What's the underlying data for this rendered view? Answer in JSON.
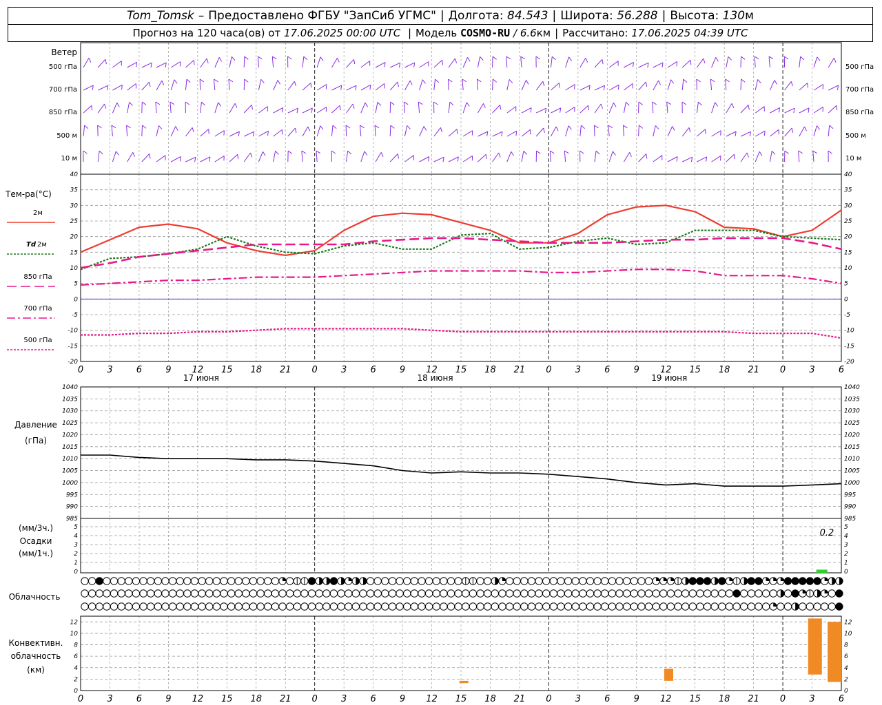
{
  "header": {
    "station": "Tom_Tomsk",
    "dash": "–",
    "provider": "Предоставлено ФГБУ \"ЗапСиб УГМС\"",
    "lon_label": "Долгота:",
    "lon_value": "84.543",
    "lat_label": "Широта:",
    "lat_value": "56.288",
    "alt_label": "Высота:",
    "alt_value": "130",
    "alt_unit": "м"
  },
  "subheader": {
    "forecast_label": "Прогноз на 120 часа(ов) от",
    "forecast_time": "17.06.2025 00:00 UTC",
    "model_label": "Модель",
    "model_name": "COSMO-RU",
    "model_res": "/ 6.6",
    "model_res_unit": "км",
    "computed_label": "Рассчитано:",
    "computed_time": "17.06.2025 04:39 UTC"
  },
  "colors": {
    "wind": "#8a2be2",
    "t2m": "#ee3b30",
    "td2m": "#1a7a1a",
    "t850": "#e8178a",
    "t700": "#e8178a",
    "t500": "#e8178a",
    "zero": "#3030dd",
    "pressure": "#000000",
    "precip": "#33cc33",
    "conv": "#f08a24",
    "grid": "#9a9a9a"
  },
  "chart_data": {
    "type": "meteogram",
    "time_hours": [
      0,
      3,
      6,
      9,
      12,
      15,
      18,
      21,
      24,
      27,
      30,
      33,
      36,
      39,
      42,
      45,
      48,
      51,
      54,
      57,
      60,
      63,
      66,
      69,
      72,
      75,
      78
    ],
    "hour_tick_labels": [
      "0",
      "3",
      "6",
      "9",
      "12",
      "15",
      "18",
      "21",
      "0",
      "3",
      "6",
      "9",
      "12",
      "15",
      "18",
      "21",
      "0",
      "3",
      "6",
      "9",
      "12",
      "15",
      "18",
      "21",
      "0",
      "3",
      "6"
    ],
    "day_labels": [
      "17 июня",
      "18 июня",
      "19 июня"
    ],
    "wind": {
      "title": "Ветер",
      "levels": [
        "500 гПа",
        "700 гПа",
        "850 гПа",
        "500 м",
        "10 м"
      ]
    },
    "temperature": {
      "title": "Тем-ра(°C)",
      "ylim": [
        -20,
        40
      ],
      "ticks": [
        40,
        35,
        30,
        25,
        20,
        15,
        10,
        5,
        0,
        -5,
        -10,
        -15,
        -20
      ],
      "series": [
        {
          "name": "2м",
          "style": "solid",
          "x": [
            0,
            3,
            6,
            9,
            12,
            15,
            18,
            21,
            24,
            27,
            30,
            33,
            36,
            39,
            42,
            45,
            48,
            51,
            54,
            57,
            60,
            63,
            66,
            69,
            72,
            75,
            78
          ],
          "values": [
            15,
            19,
            23,
            24,
            22.5,
            18,
            15.5,
            14,
            15.5,
            22,
            26.5,
            27.5,
            27,
            24.5,
            22,
            18,
            18,
            21,
            27,
            29.5,
            30,
            28,
            23,
            22.5,
            20,
            22,
            28.5
          ]
        },
        {
          "name": "Td",
          "style": "dotted",
          "x": [
            0,
            3,
            6,
            9,
            12,
            15,
            18,
            21,
            24,
            27,
            30,
            33,
            36,
            39,
            42,
            45,
            48,
            51,
            54,
            57,
            60,
            63,
            66,
            69,
            72,
            75,
            78
          ],
          "values": [
            9.5,
            13,
            13.5,
            14.5,
            16,
            20,
            17,
            15,
            14.5,
            17,
            18,
            16,
            16,
            20.5,
            21,
            16,
            16.5,
            18.5,
            19.5,
            17.5,
            18,
            22,
            22,
            22,
            20,
            19.5,
            19
          ]
        },
        {
          "name": "850 гПа",
          "style": "long-dash",
          "x": [
            0,
            3,
            6,
            9,
            12,
            15,
            18,
            21,
            24,
            27,
            30,
            33,
            36,
            39,
            42,
            45,
            48,
            51,
            54,
            57,
            60,
            63,
            66,
            69,
            72,
            75,
            78
          ],
          "values": [
            10,
            11.5,
            13.5,
            14.5,
            15.5,
            16.5,
            17.5,
            17.5,
            17.5,
            17.5,
            18.5,
            19,
            19.5,
            19.5,
            19,
            18.5,
            18,
            18,
            18,
            18.5,
            19,
            19,
            19.5,
            19.5,
            19.5,
            18,
            16
          ]
        },
        {
          "name": "700 гПа",
          "style": "dash-dot",
          "x": [
            0,
            3,
            6,
            9,
            12,
            15,
            18,
            21,
            24,
            27,
            30,
            33,
            36,
            39,
            42,
            45,
            48,
            51,
            54,
            57,
            60,
            63,
            66,
            69,
            72,
            75,
            78
          ],
          "values": [
            4.5,
            5,
            5.5,
            6,
            6,
            6.5,
            7,
            7,
            7,
            7.5,
            8,
            8.5,
            9,
            9,
            9,
            9,
            8.5,
            8.5,
            9,
            9.5,
            9.5,
            9,
            7.5,
            7.5,
            7.5,
            6.5,
            5
          ]
        },
        {
          "name": "500 гПа",
          "style": "dotted",
          "x": [
            0,
            3,
            6,
            9,
            12,
            15,
            18,
            21,
            24,
            27,
            30,
            33,
            36,
            39,
            42,
            45,
            48,
            51,
            54,
            57,
            60,
            63,
            66,
            69,
            72,
            75,
            78
          ],
          "values": [
            -11.5,
            -11.5,
            -11,
            -11,
            -10.5,
            -10.5,
            -10,
            -9.5,
            -9.5,
            -9.5,
            -9.5,
            -9.5,
            -10,
            -10.5,
            -10.5,
            -10.5,
            -10.5,
            -10.5,
            -10.5,
            -10.5,
            -10.5,
            -10.5,
            -10.5,
            -11,
            -11,
            -11,
            -12.5
          ]
        }
      ]
    },
    "pressure": {
      "title": "Давление",
      "unit": "(гПа)",
      "ylim": [
        985,
        1040
      ],
      "ticks": [
        1040,
        1035,
        1030,
        1025,
        1020,
        1015,
        1010,
        1005,
        1000,
        995,
        990,
        985
      ],
      "x": [
        0,
        3,
        6,
        9,
        12,
        15,
        18,
        21,
        24,
        27,
        30,
        33,
        36,
        39,
        42,
        45,
        48,
        51,
        54,
        57,
        60,
        63,
        66,
        69,
        72,
        75,
        78
      ],
      "values": [
        1011.5,
        1011.5,
        1010.5,
        1010,
        1010,
        1010,
        1009.5,
        1009.5,
        1009,
        1008,
        1007,
        1005,
        1004,
        1004.5,
        1004,
        1004,
        1003.5,
        1002.5,
        1001.5,
        1000,
        999,
        999.5,
        998.5,
        998.5,
        998.5,
        999,
        999.5
      ]
    },
    "precipitation": {
      "title_top": "(мм/3ч.)",
      "title": "Осадки",
      "title_bottom": "(мм/1ч.)",
      "ylim": [
        0,
        5
      ],
      "ticks": [
        5,
        4,
        3,
        2,
        1,
        0
      ],
      "annotation": "0.2",
      "bars": [
        {
          "x": 76,
          "value": 0.2
        }
      ]
    },
    "cloudiness": {
      "title": "Облачность",
      "rows": [
        [
          0,
          0,
          4,
          0,
          0,
          0,
          0,
          0,
          0,
          0,
          0,
          0,
          0,
          0,
          0,
          0,
          0,
          0,
          0,
          0,
          0,
          0,
          0,
          0,
          0,
          0,
          0,
          2,
          0,
          1,
          1,
          4,
          3,
          3,
          4,
          3,
          2,
          3,
          3,
          0,
          0,
          0,
          0,
          0,
          0,
          0,
          0,
          0,
          0,
          0,
          0,
          0,
          1,
          1,
          0,
          0,
          3,
          2,
          0,
          0,
          0,
          0,
          0,
          0,
          0,
          0,
          0,
          0,
          0,
          0,
          0,
          0,
          0,
          0,
          0,
          0,
          0,
          0,
          2,
          2,
          2,
          1,
          3,
          4,
          4,
          4,
          3,
          4,
          2,
          1,
          3,
          4,
          4,
          2,
          2,
          2,
          4,
          4,
          4,
          4,
          4,
          2,
          3,
          3
        ],
        [
          0,
          0,
          0,
          0,
          0,
          0,
          0,
          0,
          0,
          0,
          0,
          0,
          0,
          0,
          0,
          0,
          0,
          0,
          0,
          0,
          0,
          0,
          0,
          0,
          0,
          0,
          0,
          0,
          0,
          0,
          0,
          0,
          0,
          0,
          0,
          0,
          0,
          0,
          0,
          0,
          0,
          0,
          0,
          0,
          0,
          0,
          0,
          0,
          0,
          0,
          0,
          0,
          0,
          0,
          0,
          0,
          0,
          0,
          0,
          0,
          0,
          0,
          0,
          0,
          0,
          0,
          0,
          0,
          0,
          0,
          0,
          0,
          0,
          0,
          0,
          0,
          0,
          0,
          0,
          0,
          0,
          0,
          0,
          0,
          0,
          0,
          0,
          0,
          0,
          4,
          0,
          0,
          0,
          0,
          0,
          3,
          0,
          4,
          2,
          1,
          3,
          2,
          0,
          4
        ],
        [
          0,
          0,
          0,
          0,
          0,
          0,
          0,
          0,
          0,
          0,
          0,
          0,
          0,
          0,
          0,
          0,
          0,
          0,
          0,
          0,
          0,
          0,
          0,
          0,
          0,
          0,
          0,
          0,
          0,
          0,
          0,
          0,
          0,
          0,
          0,
          0,
          0,
          0,
          0,
          0,
          0,
          0,
          0,
          0,
          0,
          0,
          0,
          0,
          0,
          0,
          0,
          0,
          0,
          0,
          0,
          0,
          0,
          0,
          0,
          0,
          0,
          0,
          0,
          0,
          0,
          0,
          0,
          0,
          0,
          0,
          0,
          0,
          0,
          0,
          0,
          0,
          0,
          0,
          0,
          0,
          0,
          0,
          0,
          0,
          0,
          0,
          0,
          0,
          0,
          0,
          0,
          0,
          0,
          0,
          2,
          0,
          0,
          3,
          0,
          0,
          0,
          0,
          0,
          4
        ]
      ]
    },
    "convective": {
      "title": "Конвективн.",
      "title2": "облачность",
      "unit": "(км)",
      "ylim": [
        0,
        13
      ],
      "ticks": [
        12,
        10,
        8,
        6,
        4,
        2,
        0
      ],
      "bars": [
        {
          "x": 39.3,
          "base": 1.3,
          "top": 1.7
        },
        {
          "x": 60.3,
          "base": 1.7,
          "top": 3.8
        },
        {
          "x": 75.3,
          "base": 2.8,
          "top": 12.6
        },
        {
          "x": 77.3,
          "base": 1.5,
          "top": 12.0
        }
      ]
    }
  }
}
